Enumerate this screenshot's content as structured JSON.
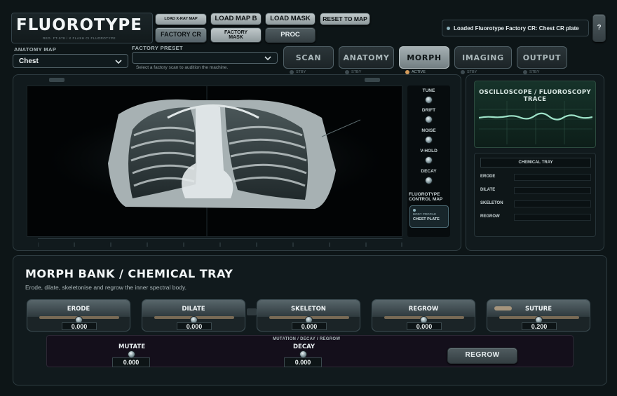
{
  "header": {
    "logo_title": "FLUOROTYPE",
    "logo_subtitle": "REG. FT-978 / X   FLASH CI FLUOROTYPE",
    "buttons": {
      "load_xray_map": "LOAD X-RAY MAP",
      "load_map_b": "LOAD MAP B",
      "load_mask": "LOAD MASK",
      "reset_to_map": "RESET TO MAP",
      "factory_cr": "FACTORY CR",
      "factory_mask": "FACTORY MASK",
      "proc": "PROC"
    },
    "status_text": "Loaded Fluorotype Factory CR: Chest CR plate",
    "help_label": "?"
  },
  "anatomy_map": {
    "label": "ANATOMY MAP",
    "value": "Chest"
  },
  "factory_preset": {
    "label": "FACTORY PRESET",
    "value": "",
    "hint": "Select a factory scan to audition the machine."
  },
  "tabs": [
    {
      "label": "SCAN",
      "status": "STBY",
      "active": false
    },
    {
      "label": "ANATOMY",
      "status": "STBY",
      "active": false
    },
    {
      "label": "MORPH",
      "status": "ACTIVE",
      "active": true
    },
    {
      "label": "IMAGING",
      "status": "STBY",
      "active": false
    },
    {
      "label": "OUTPUT",
      "status": "STBY",
      "active": false
    }
  ],
  "controls": {
    "knobs": [
      "TUNE",
      "DRIFT",
      "NOISE",
      "V-HOLD",
      "DECAY"
    ],
    "control_map_label": "FLUOROTYPE CONTROL MAP",
    "map_card_small": "BODY PROFILE",
    "map_card_value": "CHEST PLATE"
  },
  "scope": {
    "title": "OSCILLOSCOPE / FLUOROSCOPY TRACE"
  },
  "tray": {
    "title": "CHEMICAL TRAY",
    "rows": [
      "ERODE",
      "DILATE",
      "SKELETON",
      "REGROW"
    ]
  },
  "morph_bank": {
    "title": "MORPH BANK / CHEMICAL TRAY",
    "subtitle": "Erode, dilate, skeletonise and regrow the inner spectral body.",
    "slots": [
      {
        "label": "ERODE",
        "value": "0.000"
      },
      {
        "label": "DILATE",
        "value": "0.000"
      },
      {
        "label": "SKELETON",
        "value": "0.000"
      },
      {
        "label": "REGROW",
        "value": "0.000"
      },
      {
        "label": "SUTURE",
        "value": "0.200"
      }
    ],
    "mutation": {
      "group_label": "MUTATION / DECAY / REGROW",
      "mutate_label": "MUTATE",
      "mutate_value": "0.000",
      "decay_label": "DECAY",
      "decay_value": "0.000",
      "regrow_button": "REGROW"
    }
  },
  "colors": {
    "background": "#0d1517",
    "active_led": "#d39b5b",
    "scope_trace": "#9fe3c9"
  }
}
